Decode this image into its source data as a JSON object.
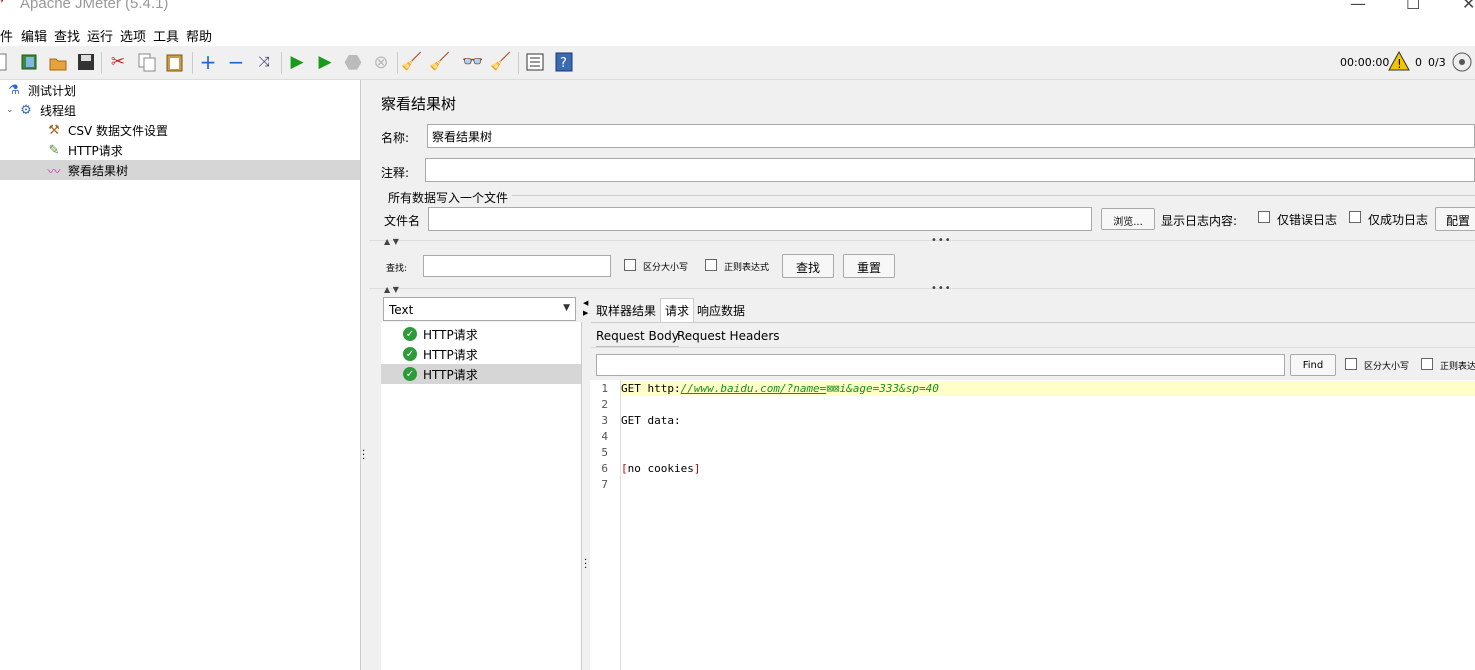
{
  "window": {
    "title": "Apache JMeter (5.4.1)",
    "min": "—",
    "max": "☐",
    "close": "✕"
  },
  "menu": [
    "件",
    "编辑",
    "查找",
    "运行",
    "选项",
    "工具",
    "帮助"
  ],
  "toolbar": {
    "timer": "00:00:00",
    "warn_count": "0",
    "threads": "0/3"
  },
  "tree": {
    "items": [
      {
        "label": "测试计划",
        "icon": "flask-icon"
      },
      {
        "label": "线程组",
        "icon": "gear-icon"
      },
      {
        "label": "CSV 数据文件设置",
        "icon": "tools-icon"
      },
      {
        "label": "HTTP请求",
        "icon": "pipette-icon"
      },
      {
        "label": "察看结果树",
        "icon": "graph-icon"
      }
    ]
  },
  "panel": {
    "title": "察看结果树",
    "name_label": "名称:",
    "name_value": "察看结果树",
    "comment_label": "注释:",
    "comment_value": "",
    "file_group": "所有数据写入一个文件",
    "file_label": "文件名",
    "file_value": "",
    "browse": "浏览...",
    "log_label": "显示日志内容:",
    "errors_only": "仅错误日志",
    "success_only": "仅成功日志",
    "config": "配置"
  },
  "search": {
    "label": "查找:",
    "value": "",
    "case": "区分大小写",
    "regex": "正则表达式",
    "find": "查找",
    "reset": "重置"
  },
  "results": {
    "renderer": "Text",
    "items": [
      "HTTP请求",
      "HTTP请求",
      "HTTP请求"
    ],
    "selected_index": 2
  },
  "tabs": {
    "main": [
      "取样器结果",
      "请求",
      "响应数据"
    ],
    "active_main": "请求",
    "sub": [
      "Request Body",
      "Request Headers"
    ],
    "active_sub": "Request Body"
  },
  "inner_search": {
    "value": "",
    "find": "Find",
    "case": "区分大小写",
    "regex": "正则表达"
  },
  "code": {
    "lines": [
      {
        "n": "1",
        "text": "GET http://www.baidu.com/?name=⊠⊠i&age=333&sp=40"
      },
      {
        "n": "2",
        "text": ""
      },
      {
        "n": "3",
        "text": "GET data:"
      },
      {
        "n": "4",
        "text": ""
      },
      {
        "n": "5",
        "text": ""
      },
      {
        "n": "6",
        "text": "[no cookies]"
      },
      {
        "n": "7",
        "text": ""
      }
    ],
    "url_prefix": "GET http:",
    "url_link": "//www.baidu.com/?name=",
    "url_rest": "⊠⊠i&age=333&sp=40",
    "no_cookies": "no cookies"
  },
  "colors": {
    "selection": "#d6d6d6",
    "highlight": "#ffffc8",
    "link": "#1a8f1a",
    "bracket": "#cc0000"
  }
}
